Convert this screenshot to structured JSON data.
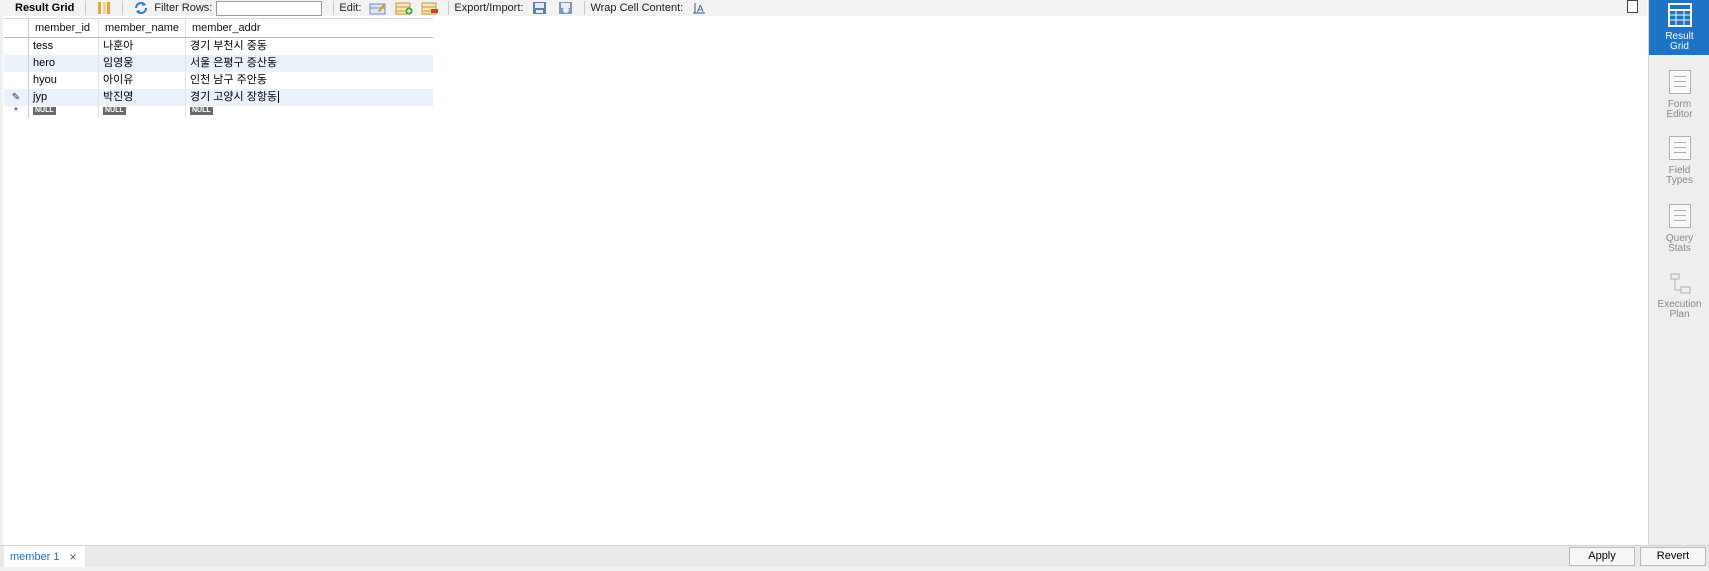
{
  "toolbar": {
    "title": "Result Grid",
    "filter_label": "Filter Rows:",
    "filter_value": "",
    "edit_label": "Edit:",
    "export_label": "Export/Import:",
    "wrap_label": "Wrap Cell Content:",
    "icons": [
      "grid-layout-icon",
      "refresh-icon",
      "edit-row-icon",
      "insert-row-icon",
      "delete-row-icon",
      "export-icon",
      "import-icon",
      "wrap-text-icon"
    ]
  },
  "grid": {
    "columns": [
      "member_id",
      "member_name",
      "member_addr"
    ],
    "rows": [
      {
        "marker": "",
        "member_id": "tess",
        "member_name": "나훈아",
        "member_addr": "경기 부천시 중동"
      },
      {
        "marker": "",
        "member_id": "hero",
        "member_name": "임영웅",
        "member_addr": "서울 은평구 증산동"
      },
      {
        "marker": "",
        "member_id": "hyou",
        "member_name": "아이유",
        "member_addr": "인천 남구 주안동"
      },
      {
        "marker": "✎",
        "member_id": "jyp",
        "member_name": "박진영",
        "member_addr": "경기 고양시 장항동"
      }
    ],
    "new_row": {
      "marker": "*",
      "null_label": "NULL"
    }
  },
  "right_panel": {
    "items": [
      {
        "label_1": "Result",
        "label_2": "Grid",
        "active": true
      },
      {
        "label_1": "Form",
        "label_2": "Editor",
        "active": false
      },
      {
        "label_1": "Field",
        "label_2": "Types",
        "active": false
      },
      {
        "label_1": "Query",
        "label_2": "Stats",
        "active": false
      },
      {
        "label_1": "Execution",
        "label_2": "Plan",
        "active": false
      }
    ]
  },
  "bottom": {
    "tab_label": "member 1",
    "close_glyph": "×",
    "apply_label": "Apply",
    "revert_label": "Revert"
  },
  "colors": {
    "accent": "#1d74c6",
    "alt_row": "#eaf1fb",
    "null_badge": "#6a6a6a"
  }
}
